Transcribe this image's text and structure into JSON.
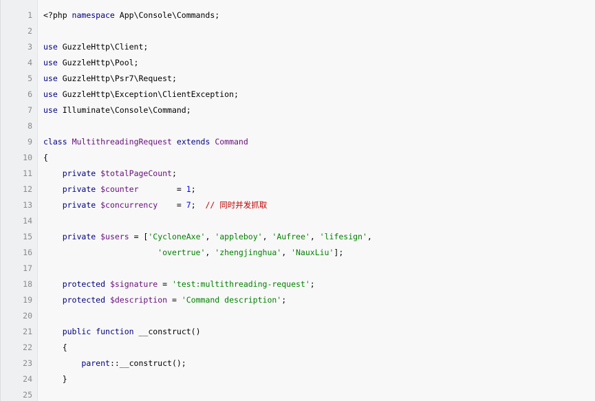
{
  "lines": [
    {
      "n": "1",
      "tokens": [
        {
          "cls": "t",
          "text": "<?php "
        },
        {
          "cls": "k",
          "text": "namespace"
        },
        {
          "cls": "t",
          "text": " App\\Console\\Commands;"
        }
      ]
    },
    {
      "n": "2",
      "tokens": []
    },
    {
      "n": "3",
      "tokens": [
        {
          "cls": "k",
          "text": "use"
        },
        {
          "cls": "t",
          "text": " GuzzleHttp\\Client;"
        }
      ]
    },
    {
      "n": "4",
      "tokens": [
        {
          "cls": "k",
          "text": "use"
        },
        {
          "cls": "t",
          "text": " GuzzleHttp\\Pool;"
        }
      ]
    },
    {
      "n": "5",
      "tokens": [
        {
          "cls": "k",
          "text": "use"
        },
        {
          "cls": "t",
          "text": " GuzzleHttp\\Psr7\\Request;"
        }
      ]
    },
    {
      "n": "6",
      "tokens": [
        {
          "cls": "k",
          "text": "use"
        },
        {
          "cls": "t",
          "text": " GuzzleHttp\\Exception\\ClientException;"
        }
      ]
    },
    {
      "n": "7",
      "tokens": [
        {
          "cls": "k",
          "text": "use"
        },
        {
          "cls": "t",
          "text": " Illuminate\\Console\\Command;"
        }
      ]
    },
    {
      "n": "8",
      "tokens": []
    },
    {
      "n": "9",
      "tokens": [
        {
          "cls": "k",
          "text": "class"
        },
        {
          "cls": "t",
          "text": " "
        },
        {
          "cls": "cls",
          "text": "MultithreadingRequest"
        },
        {
          "cls": "t",
          "text": " "
        },
        {
          "cls": "k",
          "text": "extends"
        },
        {
          "cls": "t",
          "text": " "
        },
        {
          "cls": "cls",
          "text": "Command"
        }
      ]
    },
    {
      "n": "10",
      "tokens": [
        {
          "cls": "t",
          "text": "{"
        }
      ]
    },
    {
      "n": "11",
      "tokens": [
        {
          "cls": "t",
          "text": "    "
        },
        {
          "cls": "k",
          "text": "private"
        },
        {
          "cls": "t",
          "text": " "
        },
        {
          "cls": "v",
          "text": "$totalPageCount"
        },
        {
          "cls": "t",
          "text": ";"
        }
      ]
    },
    {
      "n": "12",
      "tokens": [
        {
          "cls": "t",
          "text": "    "
        },
        {
          "cls": "k",
          "text": "private"
        },
        {
          "cls": "t",
          "text": " "
        },
        {
          "cls": "v",
          "text": "$counter"
        },
        {
          "cls": "t",
          "text": "        = "
        },
        {
          "cls": "n",
          "text": "1"
        },
        {
          "cls": "t",
          "text": ";"
        }
      ]
    },
    {
      "n": "13",
      "tokens": [
        {
          "cls": "t",
          "text": "    "
        },
        {
          "cls": "k",
          "text": "private"
        },
        {
          "cls": "t",
          "text": " "
        },
        {
          "cls": "v",
          "text": "$concurrency"
        },
        {
          "cls": "t",
          "text": "    = "
        },
        {
          "cls": "n",
          "text": "7"
        },
        {
          "cls": "t",
          "text": ";  "
        },
        {
          "cls": "c",
          "text": "// 同时并发抓取"
        }
      ]
    },
    {
      "n": "14",
      "tokens": []
    },
    {
      "n": "15",
      "tokens": [
        {
          "cls": "t",
          "text": "    "
        },
        {
          "cls": "k",
          "text": "private"
        },
        {
          "cls": "t",
          "text": " "
        },
        {
          "cls": "v",
          "text": "$users"
        },
        {
          "cls": "t",
          "text": " = ["
        },
        {
          "cls": "s",
          "text": "'CycloneAxe'"
        },
        {
          "cls": "t",
          "text": ", "
        },
        {
          "cls": "s",
          "text": "'appleboy'"
        },
        {
          "cls": "t",
          "text": ", "
        },
        {
          "cls": "s",
          "text": "'Aufree'"
        },
        {
          "cls": "t",
          "text": ", "
        },
        {
          "cls": "s",
          "text": "'lifesign'"
        },
        {
          "cls": "t",
          "text": ","
        }
      ]
    },
    {
      "n": "16",
      "tokens": [
        {
          "cls": "t",
          "text": "                        "
        },
        {
          "cls": "s",
          "text": "'overtrue'"
        },
        {
          "cls": "t",
          "text": ", "
        },
        {
          "cls": "s",
          "text": "'zhengjinghua'"
        },
        {
          "cls": "t",
          "text": ", "
        },
        {
          "cls": "s",
          "text": "'NauxLiu'"
        },
        {
          "cls": "t",
          "text": "];"
        }
      ]
    },
    {
      "n": "17",
      "tokens": []
    },
    {
      "n": "18",
      "tokens": [
        {
          "cls": "t",
          "text": "    "
        },
        {
          "cls": "k",
          "text": "protected"
        },
        {
          "cls": "t",
          "text": " "
        },
        {
          "cls": "v",
          "text": "$signature"
        },
        {
          "cls": "t",
          "text": " = "
        },
        {
          "cls": "s",
          "text": "'test:multithreading-request'"
        },
        {
          "cls": "t",
          "text": ";"
        }
      ]
    },
    {
      "n": "19",
      "tokens": [
        {
          "cls": "t",
          "text": "    "
        },
        {
          "cls": "k",
          "text": "protected"
        },
        {
          "cls": "t",
          "text": " "
        },
        {
          "cls": "v",
          "text": "$description"
        },
        {
          "cls": "t",
          "text": " = "
        },
        {
          "cls": "s",
          "text": "'Command description'"
        },
        {
          "cls": "t",
          "text": ";"
        }
      ]
    },
    {
      "n": "20",
      "tokens": []
    },
    {
      "n": "21",
      "tokens": [
        {
          "cls": "t",
          "text": "    "
        },
        {
          "cls": "k",
          "text": "public"
        },
        {
          "cls": "t",
          "text": " "
        },
        {
          "cls": "k",
          "text": "function"
        },
        {
          "cls": "t",
          "text": " __construct()"
        }
      ]
    },
    {
      "n": "22",
      "tokens": [
        {
          "cls": "t",
          "text": "    {"
        }
      ]
    },
    {
      "n": "23",
      "tokens": [
        {
          "cls": "t",
          "text": "        "
        },
        {
          "cls": "k",
          "text": "parent"
        },
        {
          "cls": "t",
          "text": "::__construct();"
        }
      ]
    },
    {
      "n": "24",
      "tokens": [
        {
          "cls": "t",
          "text": "    }"
        }
      ]
    },
    {
      "n": "25",
      "tokens": []
    }
  ]
}
